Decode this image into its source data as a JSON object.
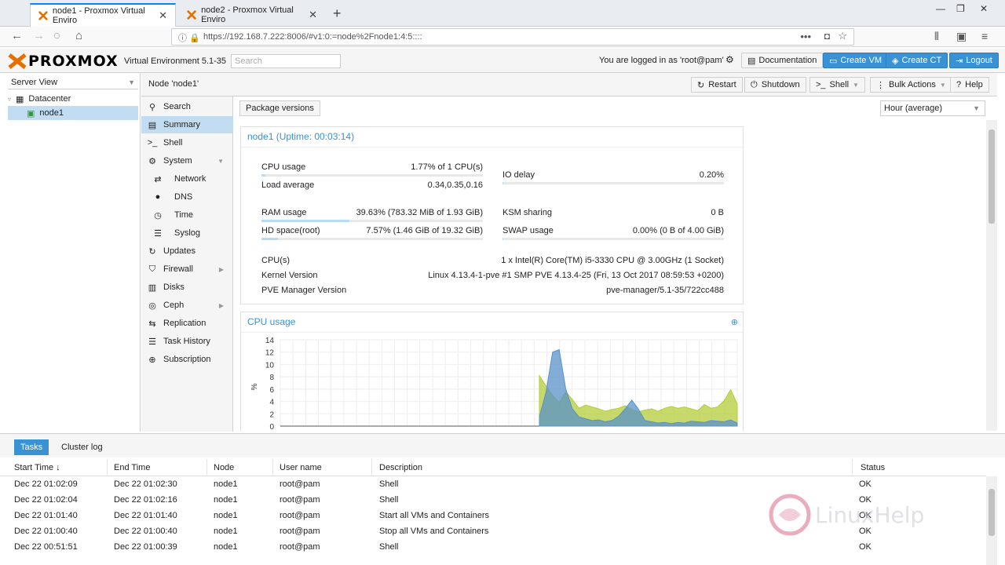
{
  "browser": {
    "tabs": [
      {
        "title": "node1 - Proxmox Virtual Enviro"
      },
      {
        "title": "node2 - Proxmox Virtual Enviro"
      }
    ],
    "url": "https://192.168.7.222:8006/#v1:0:=node%2Fnode1:4:5::::"
  },
  "header": {
    "brand": "PROXMOX",
    "version": "Virtual Environment 5.1-35",
    "search_placeholder": "Search",
    "logged_in": "You are logged in as 'root@pam'",
    "buttons": {
      "documentation": "Documentation",
      "create_vm": "Create VM",
      "create_ct": "Create CT",
      "logout": "Logout"
    }
  },
  "tree": {
    "view": "Server View",
    "datacenter": "Datacenter",
    "node": "node1"
  },
  "nodebar": {
    "title": "Node 'node1'",
    "restart": "Restart",
    "shutdown": "Shutdown",
    "shell": "Shell",
    "bulk": "Bulk Actions",
    "help": "Help"
  },
  "menu": {
    "items": [
      {
        "label": "Search"
      },
      {
        "label": "Summary"
      },
      {
        "label": "Shell"
      },
      {
        "label": "System"
      },
      {
        "label": "Network"
      },
      {
        "label": "DNS"
      },
      {
        "label": "Time"
      },
      {
        "label": "Syslog"
      },
      {
        "label": "Updates"
      },
      {
        "label": "Firewall"
      },
      {
        "label": "Disks"
      },
      {
        "label": "Ceph"
      },
      {
        "label": "Replication"
      },
      {
        "label": "Task History"
      },
      {
        "label": "Subscription"
      }
    ]
  },
  "content": {
    "package_versions": "Package versions",
    "timeframe": "Hour (average)",
    "summary": {
      "title": "node1 (Uptime: 00:03:14)",
      "cpu_usage_label": "CPU usage",
      "cpu_usage_value": "1.77% of 1 CPU(s)",
      "cpu_usage_fraction": 0.0177,
      "load_label": "Load average",
      "load_value": "0.34,0.35,0.16",
      "io_label": "IO delay",
      "io_value": "0.20%",
      "io_fraction": 0.002,
      "ram_label": "RAM usage",
      "ram_value": "39.63% (783.32 MiB of 1.93 GiB)",
      "ram_fraction": 0.3963,
      "ksm_label": "KSM sharing",
      "ksm_value": "0 B",
      "hd_label": "HD space(root)",
      "hd_value": "7.57% (1.46 GiB of 19.32 GiB)",
      "hd_fraction": 0.0757,
      "swap_label": "SWAP usage",
      "swap_value": "0.00% (0 B of 4.00 GiB)",
      "swap_fraction": 0.0,
      "cpus_label": "CPU(s)",
      "cpus_value": "1 x Intel(R) Core(TM) i5-3330 CPU @ 3.00GHz (1 Socket)",
      "kernel_label": "Kernel Version",
      "kernel_value": "Linux 4.13.4-1-pve #1 SMP PVE 4.13.4-25 (Fri, 13 Oct 2017 08:59:53 +0200)",
      "pve_label": "PVE Manager Version",
      "pve_value": "pve-manager/5.1-35/722cc488"
    },
    "cpu_chart_title": "CPU usage"
  },
  "chart_data": {
    "type": "area",
    "title": "CPU usage",
    "ylabel": "%",
    "ylim": [
      0,
      14
    ],
    "yticks": [
      "0",
      "2",
      "4",
      "6",
      "8",
      "10",
      "12",
      "14"
    ],
    "x": [
      0,
      1,
      2,
      3,
      4,
      5,
      6,
      7,
      8,
      9,
      10,
      11,
      12,
      13,
      14,
      15,
      16,
      17,
      18,
      19,
      20,
      21,
      22,
      23,
      24,
      25,
      26,
      27,
      28,
      29,
      30
    ],
    "series": [
      {
        "color": "#b5cc3a",
        "values": [
          8.2,
          6.5,
          5.0,
          3.8,
          5.6,
          4.3,
          2.9,
          3.4,
          3.1,
          2.8,
          2.4,
          2.7,
          2.9,
          3.3,
          2.7,
          2.3,
          2.6,
          2.8,
          2.4,
          2.9,
          3.2,
          2.9,
          3.1,
          2.8,
          2.5,
          3.5,
          2.9,
          3.1,
          4.1,
          5.9,
          3.6
        ]
      },
      {
        "color": "#5a92c8",
        "values": [
          1.5,
          5.5,
          12.0,
          12.4,
          6.0,
          2.8,
          1.5,
          1.2,
          0.9,
          1.0,
          0.7,
          0.9,
          1.6,
          2.8,
          4.2,
          2.8,
          0.9,
          0.7,
          0.5,
          0.6,
          0.4,
          0.6,
          0.5,
          0.8,
          0.7,
          0.6,
          0.9,
          0.8,
          0.7,
          1.0,
          0.5
        ]
      }
    ]
  },
  "tasks": {
    "tabs": [
      "Tasks",
      "Cluster log"
    ],
    "columns": [
      "Start Time ↓",
      "End Time",
      "Node",
      "User name",
      "Description",
      "Status"
    ],
    "rows": [
      [
        "Dec 22 01:02:09",
        "Dec 22 01:02:30",
        "node1",
        "root@pam",
        "Shell",
        "OK"
      ],
      [
        "Dec 22 01:02:04",
        "Dec 22 01:02:16",
        "node1",
        "root@pam",
        "Shell",
        "OK"
      ],
      [
        "Dec 22 01:01:40",
        "Dec 22 01:01:40",
        "node1",
        "root@pam",
        "Start all VMs and Containers",
        "OK"
      ],
      [
        "Dec 22 01:00:40",
        "Dec 22 01:00:40",
        "node1",
        "root@pam",
        "Stop all VMs and Containers",
        "OK"
      ],
      [
        "Dec 22 00:51:51",
        "Dec 22 01:00:39",
        "node1",
        "root@pam",
        "Shell",
        "OK"
      ]
    ],
    "watermark": "LinuxHelp"
  }
}
